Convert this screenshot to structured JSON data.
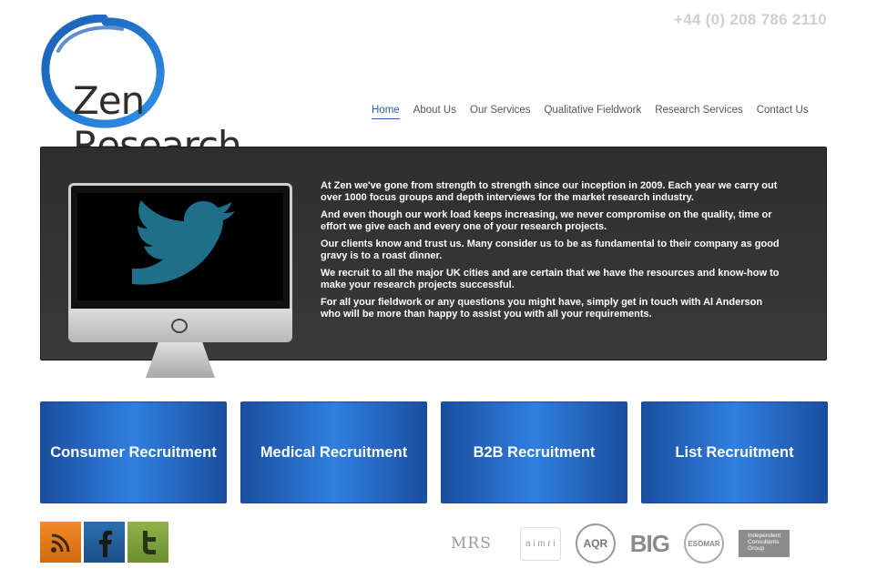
{
  "header": {
    "phone": "+44 (0) 208 786 2110",
    "logo_text": "Zen Research"
  },
  "nav": {
    "items": [
      {
        "label": "Home",
        "active": true
      },
      {
        "label": "About Us"
      },
      {
        "label": "Our Services"
      },
      {
        "label": "Qualitative Fieldwork"
      },
      {
        "label": "Research Services"
      },
      {
        "label": "Contact Us"
      }
    ]
  },
  "hero": {
    "paragraphs": [
      "At Zen we've gone from strength to strength since our inception in 2009. Each year we carry out over 1000 focus groups and depth interviews for the market research industry.",
      "And even though our work load keeps increasing, we never compromise on the quality, time or effort we give each and every one of your research projects.",
      "Our clients know and trust us. Many consider us to be as fundamental to their company as good gravy is to a roast dinner.",
      "We recruit to all the major UK cities and are certain that we have the resources and know-how to make your research projects successful.",
      "For all your fieldwork or any questions you might have, simply get in touch with Al Anderson who will be more than happy to assist you with all your requirements."
    ],
    "screen_icon": "twitter-bird-icon"
  },
  "tiles": [
    {
      "label": "Consumer Recruitment"
    },
    {
      "label": "Medical Recruitment"
    },
    {
      "label": "B2B Recruitment"
    },
    {
      "label": "List Recruitment"
    }
  ],
  "social": [
    {
      "icon": "rss-icon"
    },
    {
      "icon": "facebook-icon"
    },
    {
      "icon": "twitter-icon"
    }
  ],
  "partners": {
    "mrs": "MRS",
    "aimri": "a i m r i",
    "aqr": "AQR",
    "big": "BIG",
    "esomar": "ESOMAR",
    "icg": "Independent Consultants Group"
  },
  "colors": {
    "accent": "#2b5f9e",
    "tile_blue": "#2f7fe0",
    "hero_bg": "#333333"
  }
}
